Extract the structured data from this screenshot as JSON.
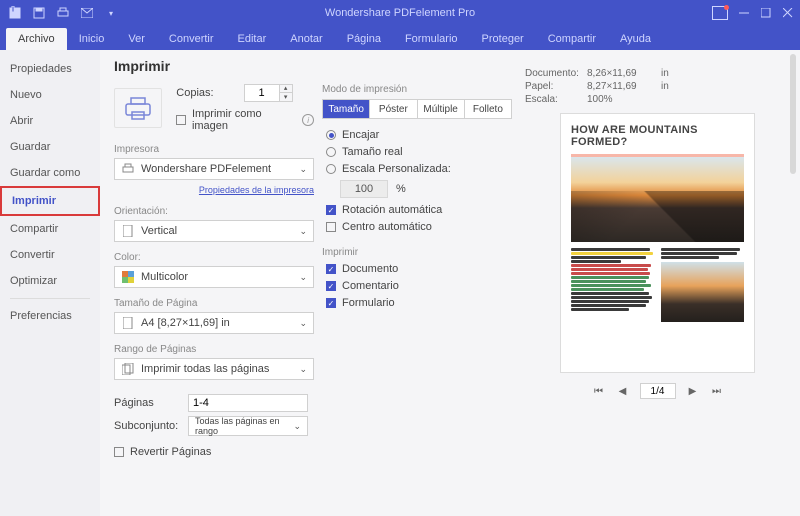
{
  "titlebar": {
    "app_title": "Wondershare PDFelement Pro"
  },
  "menu": {
    "items": [
      "Archivo",
      "Inicio",
      "Ver",
      "Convertir",
      "Editar",
      "Anotar",
      "Página",
      "Formulario",
      "Proteger",
      "Compartir",
      "Ayuda"
    ],
    "active_index": 0
  },
  "sidebar": {
    "items": [
      "Propiedades",
      "Nuevo",
      "Abrir",
      "Guardar",
      "Guardar como",
      "Imprimir",
      "Compartir",
      "Convertir",
      "Optimizar",
      "Preferencias"
    ],
    "selected_index": 5,
    "separator_after": [
      8
    ]
  },
  "print": {
    "heading": "Imprimir",
    "copies_label": "Copias:",
    "copies_value": "1",
    "print_as_image": "Imprimir como imagen",
    "printer_section": "Impresora",
    "printer_value": "Wondershare PDFelement",
    "printer_props": "Propiedades de la impresora",
    "orientation_section": "Orientación:",
    "orientation_value": "Vertical",
    "color_section": "Color:",
    "color_value": "Multicolor",
    "pagesize_section": "Tamaño de Página",
    "pagesize_value": "A4 [8,27×11,69] in",
    "pagerange_section": "Rango de Páginas",
    "pagerange_value": "Imprimir todas las páginas",
    "pages_label": "Páginas",
    "pages_value": "1-4",
    "subset_label": "Subconjunto:",
    "subset_value": "Todas las páginas en rango",
    "reverse": "Revertir Páginas"
  },
  "mode": {
    "label": "Modo de impresión",
    "tabs": [
      "Tamaño",
      "Póster",
      "Múltiple",
      "Folleto"
    ],
    "active_index": 0,
    "fit": "Encajar",
    "actual": "Tamaño real",
    "custom_scale": "Escala Personalizada:",
    "custom_value": "100",
    "percent": "%",
    "auto_rotate": "Rotación automática",
    "auto_center": "Centro automático",
    "print_section": "Imprimir",
    "opt_doc": "Documento",
    "opt_comment": "Comentario",
    "opt_form": "Formulario"
  },
  "preview": {
    "doc_label": "Documento:",
    "doc_value": "8,26×11,69",
    "paper_label": "Papel:",
    "paper_value": "8,27×11,69",
    "unit": "in",
    "scale_label": "Escala:",
    "scale_value": "100%",
    "page_heading": "HOW ARE MOUNTAINS FORMED?",
    "pager_value": "1/4"
  }
}
